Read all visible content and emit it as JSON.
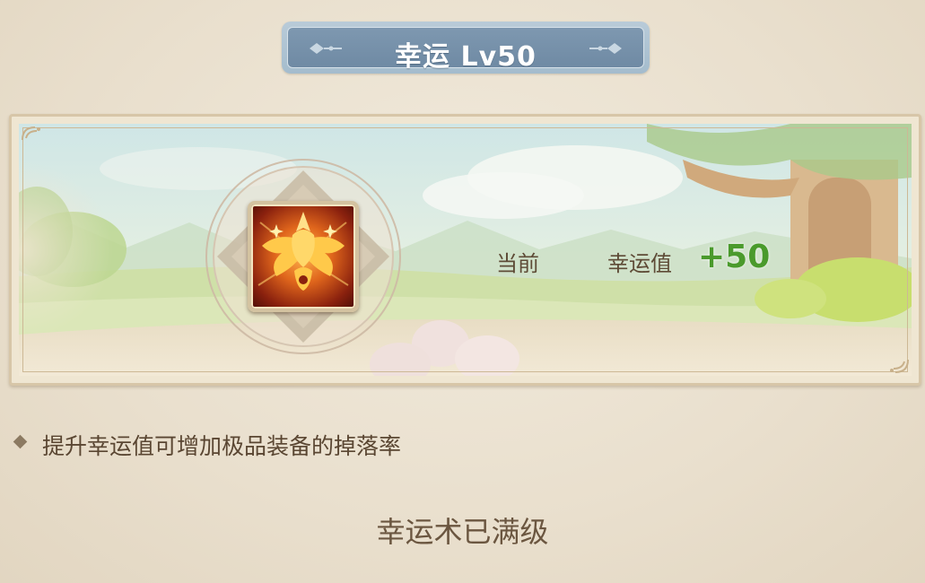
{
  "header": {
    "title": "幸运 Lv50"
  },
  "skill": {
    "icon_name": "lucky-emblem-icon",
    "current_label": "当前",
    "stat_name": "幸运值",
    "stat_value": "+50"
  },
  "description": {
    "text": "提升幸运值可增加极品装备的掉落率"
  },
  "status": {
    "text": "幸运术已满级"
  },
  "colors": {
    "banner": "#738ea7",
    "stat_value": "#4a9a2c",
    "text_brown": "#5a4632",
    "frame_border": "#d7c6a8"
  }
}
